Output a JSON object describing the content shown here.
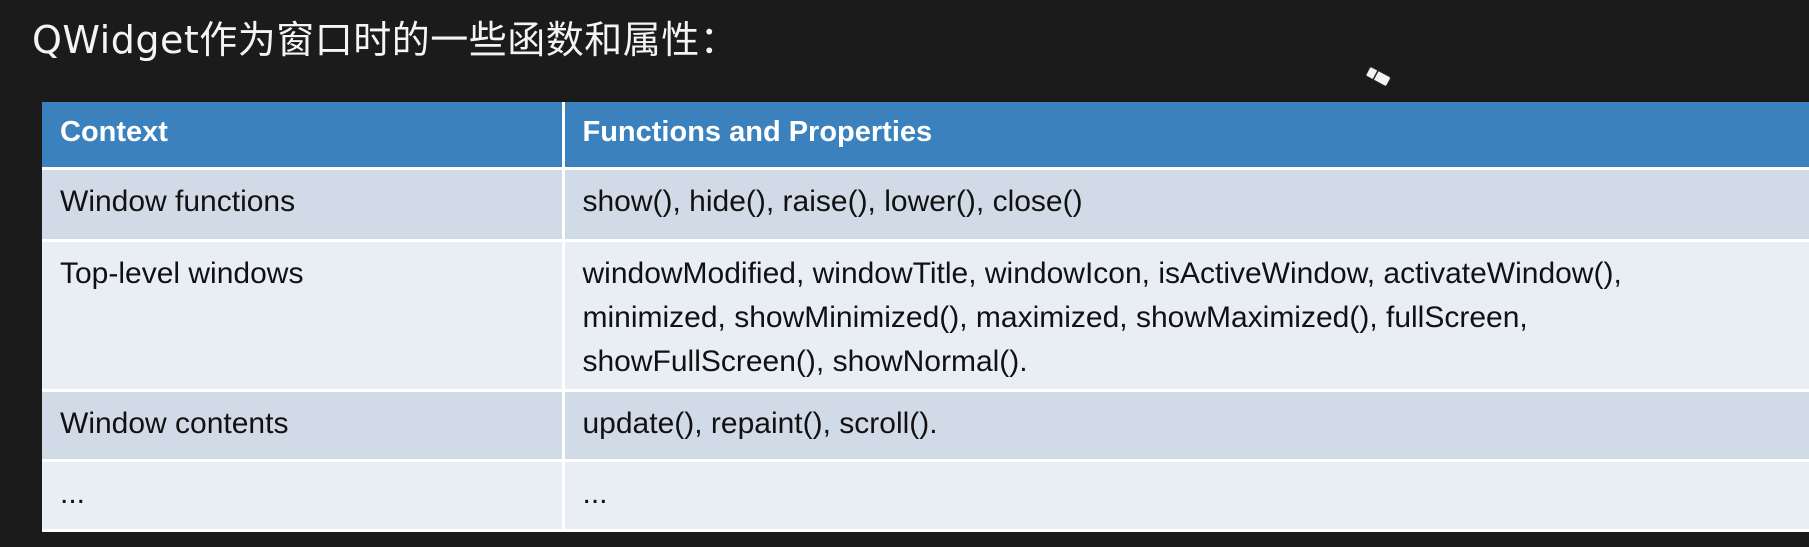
{
  "slide": {
    "title": "QWidget作为窗口时的一些函数和属性："
  },
  "cursor": {
    "icon": "eraser-icon"
  },
  "table": {
    "headers": {
      "context": "Context",
      "functions": "Functions and Properties"
    },
    "rows": [
      {
        "context": "Window functions",
        "functions": [
          "show(), hide(), raise(), lower(), close()"
        ]
      },
      {
        "context": "Top-level windows",
        "functions": [
          "windowModified, windowTitle, windowIcon, isActiveWindow, activateWindow(),",
          "minimized, showMinimized(), maximized, showMaximized(), fullScreen,",
          "showFullScreen(), showNormal()."
        ]
      },
      {
        "context": "Window contents",
        "functions": [
          "update(), repaint(), scroll()."
        ]
      },
      {
        "context": "...",
        "functions": [
          "..."
        ]
      }
    ]
  },
  "colors": {
    "background": "#1b1b1b",
    "header": "#3b81bd",
    "row_dark": "#d1dbe8",
    "row_light": "#e9eef5"
  }
}
